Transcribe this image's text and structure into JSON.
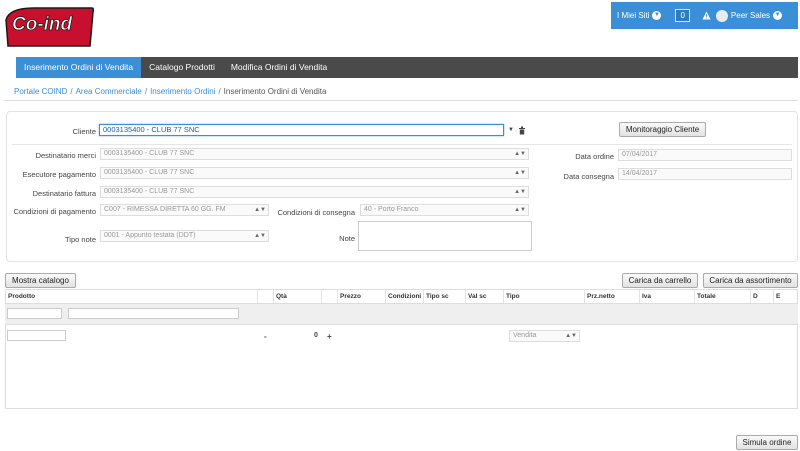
{
  "brand": {
    "logo_text": "Co-ind",
    "logo_color": "#c8102e"
  },
  "topbar": {
    "sites_label": "I Miei Siti",
    "count": "0",
    "user_name": "Peer Sales"
  },
  "nav": {
    "tabs": [
      {
        "label": "Inserimento Ordini di Vendita",
        "active": true
      },
      {
        "label": "Catalogo Prodotti",
        "active": false
      },
      {
        "label": "Modifica Ordini di Vendita",
        "active": false
      }
    ]
  },
  "breadcrumb": [
    "Portale COIND",
    "Area Commerciale",
    "Inserimento Ordini",
    "Inserimento Ordini di Vendita"
  ],
  "form": {
    "cliente_label": "Cliente",
    "cliente_value": "0003135400 - CLUB 77 SNC",
    "monitor_button": "Monitoraggio Cliente",
    "destinatario_merci_label": "Destinatario merci",
    "destinatario_merci_value": "0003135400 - CLUB 77 SNC",
    "esecutore_label": "Esecutore pagamento",
    "esecutore_value": "0003135400 - CLUB 77 SNC",
    "destinatario_fattura_label": "Destinatario fattura",
    "destinatario_fattura_value": "0003135400 - CLUB 77 SNC",
    "condizioni_pagamento_label": "Condizioni di pagamento",
    "condizioni_pagamento_value": "C007 - RIMESSA DIRETTA 60 GG. FM",
    "condizioni_consegna_label": "Condizioni di consegna",
    "condizioni_consegna_value": "40 - Porto Franco",
    "tipo_note_label": "Tipo note",
    "tipo_note_value": "0001 - Appunto testata (DDT)",
    "note_label": "Note",
    "data_ordine_label": "Data ordine",
    "data_ordine_value": "07/04/2017",
    "data_consegna_label": "Data consegna",
    "data_consegna_value": "14/04/2017"
  },
  "actions": {
    "mostra_catalogo": "Mostra catalogo",
    "carica_carrello": "Carica da carrello",
    "carica_assortimento": "Carica da assortimento",
    "simula_ordine": "Simula ordine"
  },
  "grid": {
    "headers": [
      "Prodotto",
      "Qtà",
      "Prezzo",
      "Condizioni",
      "Tipo sc",
      "Val sc",
      "Tipo",
      "Prz.netto",
      "Iva",
      "Totale",
      "D",
      "E"
    ],
    "row": {
      "minus": "-",
      "qty": "0",
      "plus": "+",
      "tipo": "Vendita"
    }
  }
}
